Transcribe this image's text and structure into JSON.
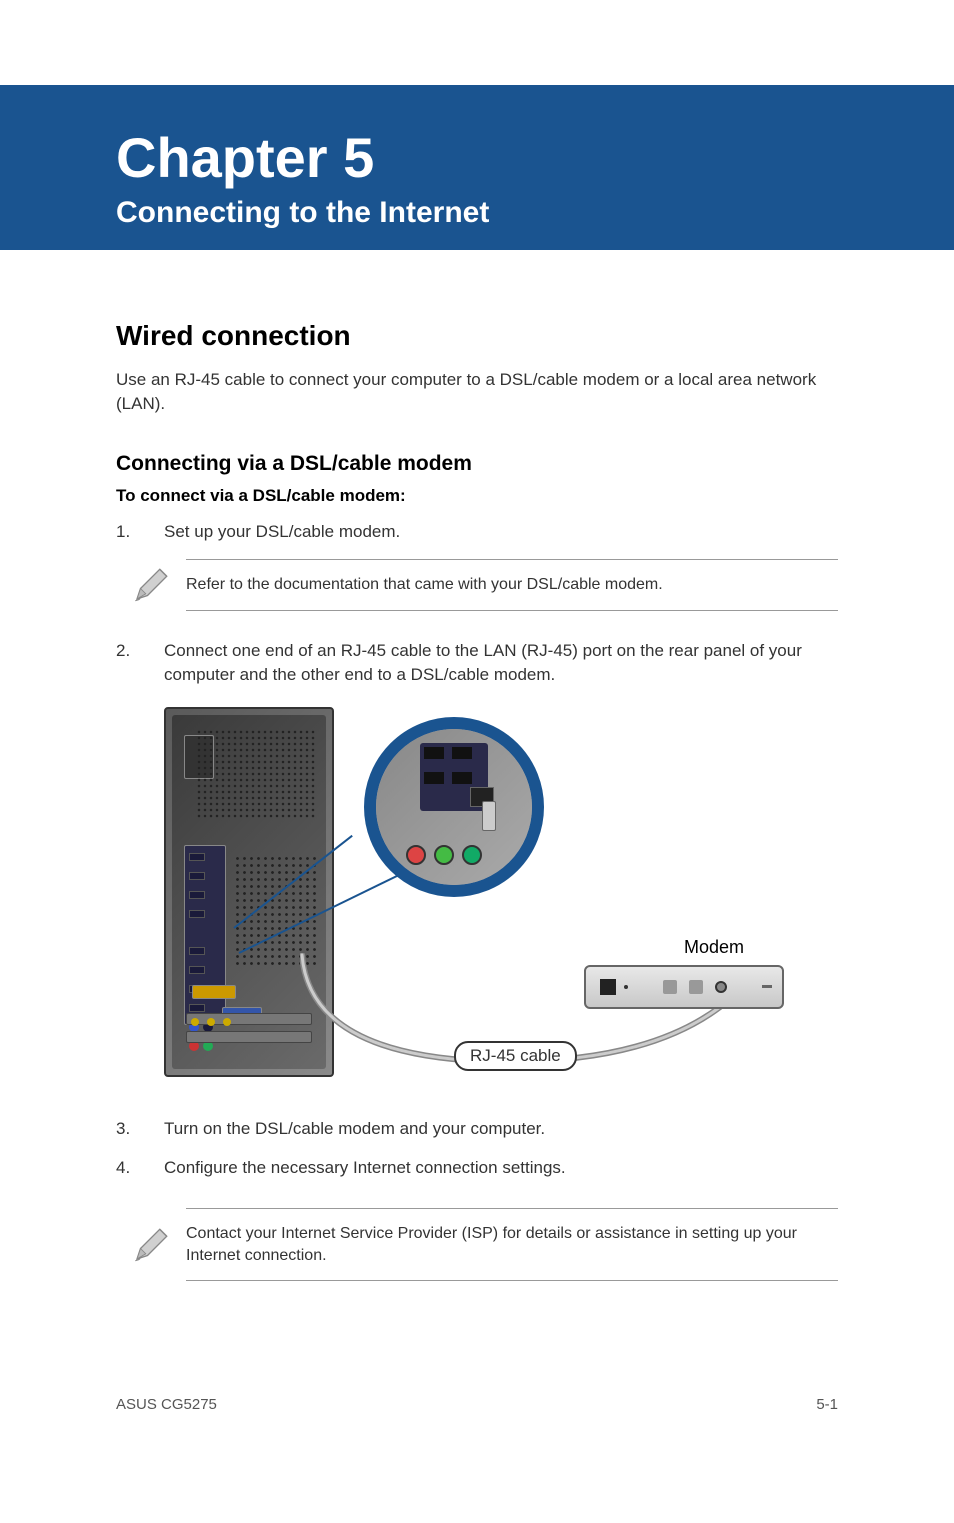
{
  "header": {
    "chapter_title": "Chapter 5",
    "chapter_subtitle": "Connecting to the Internet"
  },
  "section": {
    "heading": "Wired connection",
    "intro": "Use an RJ-45 cable to connect your computer to a DSL/cable modem or a local area network (LAN)."
  },
  "subsection": {
    "heading": "Connecting via a DSL/cable modem",
    "instruction_bold": "To connect via a DSL/cable modem:"
  },
  "steps": {
    "s1_num": "1.",
    "s1_text": "Set up your DSL/cable modem.",
    "s2_num": "2.",
    "s2_text": "Connect one end of an RJ-45 cable to the LAN (RJ-45) port on the rear panel of your computer and the other end to a DSL/cable modem.",
    "s3_num": "3.",
    "s3_text": "Turn on the DSL/cable modem and your computer.",
    "s4_num": "4.",
    "s4_text": "Configure the necessary Internet connection settings."
  },
  "notes": {
    "n1": "Refer to the documentation that came with your DSL/cable modem.",
    "n2": "Contact your Internet Service Provider (ISP) for details or assistance in setting up your Internet connection."
  },
  "diagram": {
    "modem_label": "Modem",
    "cable_label": "RJ-45 cable"
  },
  "footer": {
    "left": "ASUS CG5275",
    "right": "5-1"
  }
}
